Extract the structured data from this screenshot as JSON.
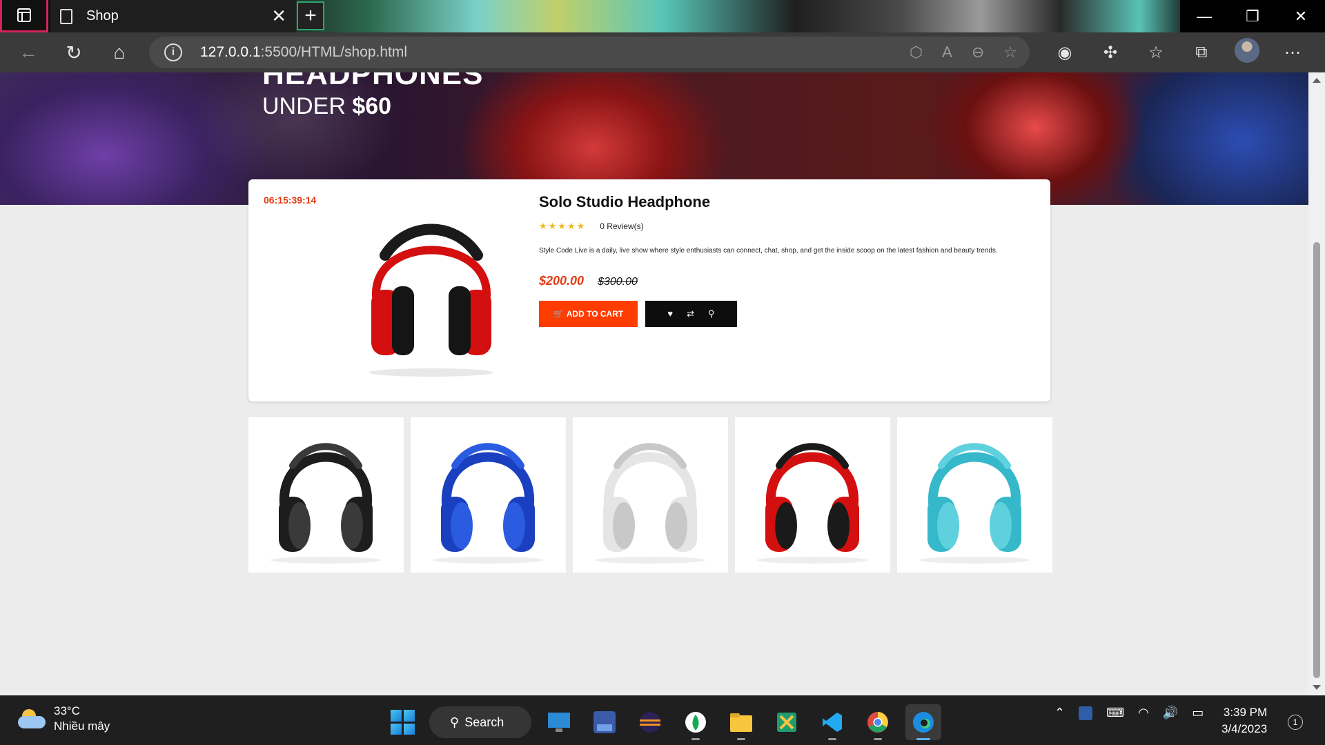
{
  "browser": {
    "tab_title": "Shop",
    "url_host": "127.0.0.1",
    "url_path": ":5500/HTML/shop.html"
  },
  "banner": {
    "title": "HEADPHONES",
    "sub_prefix": "UNDER ",
    "sub_price": "$60"
  },
  "deal": {
    "timer": "06:15:39:14",
    "product_name": "Solo Studio Headphone",
    "stars": "★★★★★",
    "reviews": "0 Review(s)",
    "description": "Style Code Live is a daily, live show where style enthusiasts can connect, chat, shop, and get the inside scoop on the latest fashion and beauty trends.",
    "price_new": "$200.00",
    "price_old": "$300.00",
    "add_to_cart": "ADD TO CART"
  },
  "thumbnails": [
    {
      "color": "#1d1d1d",
      "accent": "#3a3a3a"
    },
    {
      "color": "#1a3fbf",
      "accent": "#2a5be0"
    },
    {
      "color": "#e5e5e5",
      "accent": "#c8c8c8"
    },
    {
      "color": "#d40f0f",
      "accent": "#1a1a1a"
    },
    {
      "color": "#35b8c9",
      "accent": "#5fd0de"
    }
  ],
  "taskbar": {
    "temp": "33°C",
    "weather": "Nhiều mây",
    "search": "Search",
    "time": "3:39 PM",
    "date": "3/4/2023",
    "notifications": "1"
  }
}
